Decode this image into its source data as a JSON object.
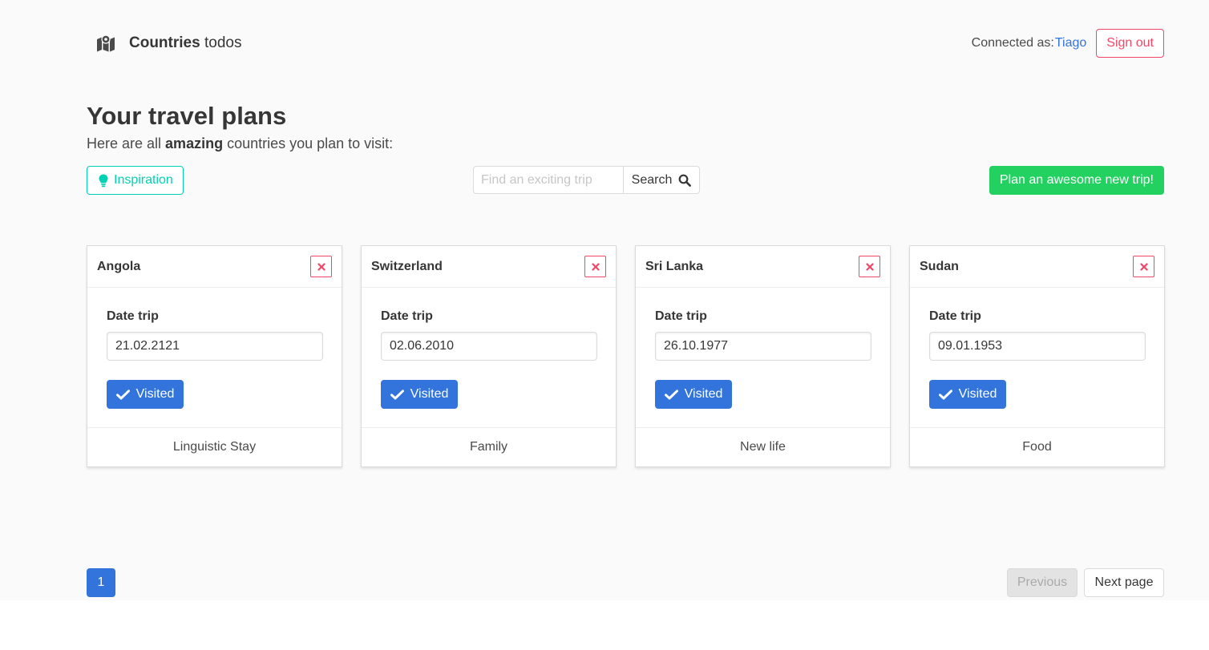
{
  "header": {
    "brand_bold": "Countries",
    "brand_light": "todos",
    "connected_label": "Connected as:",
    "user": "Tiago",
    "signout_label": "Sign out"
  },
  "hero": {
    "title": "Your travel plans",
    "subtitle_before": "Here are all ",
    "subtitle_bold": "amazing",
    "subtitle_after": " countries you plan to visit:"
  },
  "toolbar": {
    "inspiration_label": "Inspiration",
    "search_placeholder": "Find an exciting trip",
    "search_label": "Search",
    "new_trip_label": "Plan an awesome new trip!"
  },
  "cards": [
    {
      "country": "Angola",
      "date_label": "Date trip",
      "date": "21.02.2121",
      "visited_label": "Visited",
      "category": "Linguistic Stay"
    },
    {
      "country": "Switzerland",
      "date_label": "Date trip",
      "date": "02.06.2010",
      "visited_label": "Visited",
      "category": "Family"
    },
    {
      "country": "Sri Lanka",
      "date_label": "Date trip",
      "date": "26.10.1977",
      "visited_label": "Visited",
      "category": "New life"
    },
    {
      "country": "Sudan",
      "date_label": "Date trip",
      "date": "09.01.1953",
      "visited_label": "Visited",
      "category": "Food"
    }
  ],
  "pagination": {
    "current_page": "1",
    "previous_label": "Previous",
    "next_label": "Next page"
  },
  "colors": {
    "primary": "#3273dc",
    "danger": "#f14668",
    "success": "#23d160",
    "turquoise": "#00d1b2"
  },
  "icons": [
    "map-icon",
    "lightbulb-icon",
    "search-icon",
    "close-icon",
    "check-icon"
  ]
}
